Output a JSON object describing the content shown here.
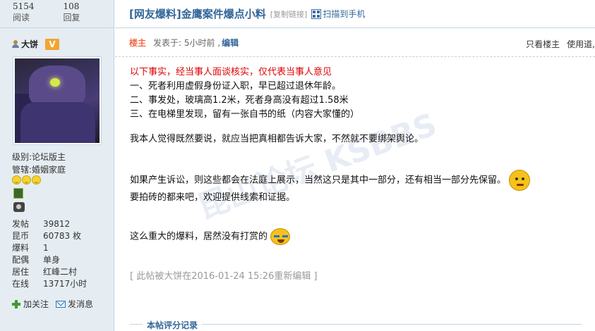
{
  "stats": {
    "views_count": "5154",
    "views_label": "阅读",
    "replies_count": "108",
    "replies_label": "回复"
  },
  "thread": {
    "title": "[网友爆料]金鹰案件爆点小料",
    "copy_link": "[复制链接]",
    "scan_to_phone": "扫描到手机"
  },
  "author": {
    "name": "大饼",
    "vip_badge": "V",
    "level_label": "级别:",
    "level_value": "论坛版主",
    "manages_label": "管辖:",
    "manages_value": "婚姻家庭",
    "info": [
      {
        "key": "发帖",
        "value": "39812"
      },
      {
        "key": "昆币",
        "value": "60783 枚"
      },
      {
        "key": "爆料",
        "value": "1"
      },
      {
        "key": "配偶",
        "value": "单身"
      },
      {
        "key": "居住",
        "value": "红峰二村"
      },
      {
        "key": "在线",
        "value": "13717小时"
      }
    ],
    "follow_label": "加关注",
    "message_label": "发消息"
  },
  "post": {
    "op_label": "楼主",
    "posted_at": "发表于: 5小时前 ,",
    "edit_label": "编辑",
    "only_op": "只看楼主",
    "use_tool": "使用道,",
    "lines": {
      "l1": "以下事实，经当事人面谈核实，仅代表当事人意见",
      "l2": "一、死者利用虚假身份证入职，早已超过退休年龄。",
      "l3": "二、事发处，玻璃高1.2米，死者身高没有超过1.58米",
      "l4": "三、在电梯里发现，留有一张自书的纸（内容大家懂的）",
      "l5": "我本人觉得既然要说，就应当把真相都告诉大家，不然就不要绑架舆论。",
      "l6": "如果产生诉讼，则这些都会在法庭上展示，当然这只是其中一部分，还有相当一部分先保留。",
      "l7": "要拍砖的都来吧，欢迎提供线索和证据。",
      "l8": "这么重大的爆料，居然没有打赏的"
    },
    "edit_note": "[ 此帖被大饼在2016-01-24 15:26重新编辑 ]",
    "rating_title": "本帖评分记录"
  },
  "watermark": "昆山论坛 KSBBS",
  "icons": {
    "user": "user-icon",
    "qr": "qr-code-icon",
    "follow": "plus-icon",
    "message": "mail-icon",
    "emoji1": "thinking-emoji-icon",
    "emoji2": "crying-emoji-icon"
  }
}
